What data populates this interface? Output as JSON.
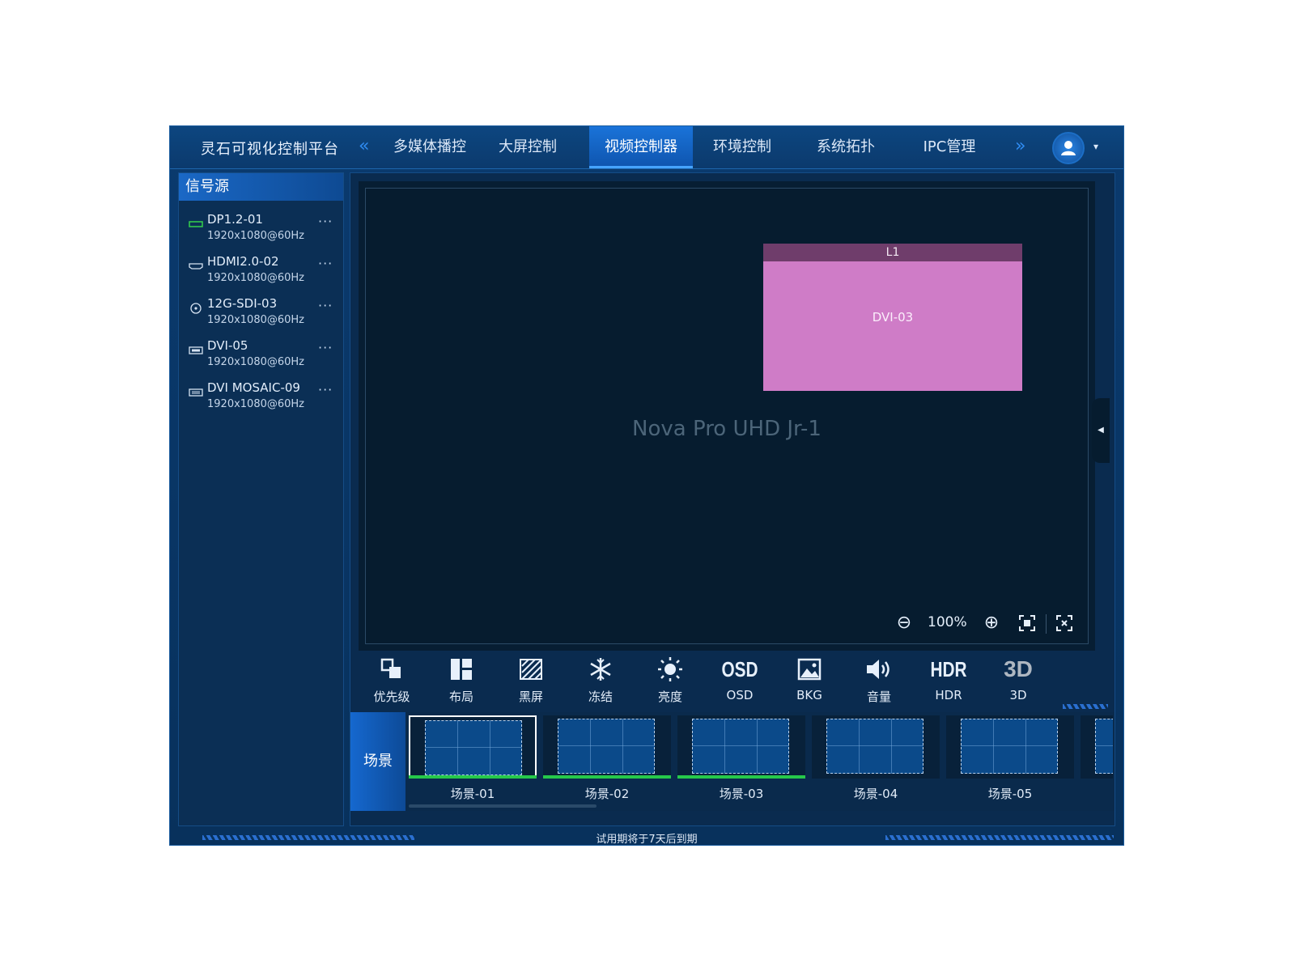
{
  "header": {
    "app_title": "灵石可视化控制平台",
    "nav_prev": "«",
    "nav_next": "»",
    "tabs": [
      {
        "label": "多媒体播控"
      },
      {
        "label": "大屏控制"
      },
      {
        "label": "视频控制器",
        "active": true
      },
      {
        "label": "环境控制"
      },
      {
        "label": "系统拓扑"
      },
      {
        "label": "IPC管理"
      }
    ],
    "avatar_icon": "user-icon",
    "avatar_caret": "▾"
  },
  "sidebar": {
    "title": "信号源",
    "items": [
      {
        "name": "DP1.2-01",
        "resolution": "1920x1080@60Hz",
        "icon": "displayport-icon",
        "more": "···"
      },
      {
        "name": "HDMI2.0-02",
        "resolution": "1920x1080@60Hz",
        "icon": "hdmi-icon",
        "more": "···"
      },
      {
        "name": "12G-SDI-03",
        "resolution": "1920x1080@60Hz",
        "icon": "sdi-icon",
        "more": "···"
      },
      {
        "name": "DVI-05",
        "resolution": "1920x1080@60Hz",
        "icon": "dvi-icon",
        "more": "···"
      },
      {
        "name": "DVI MOSAIC-09",
        "resolution": "1920x1080@60Hz",
        "icon": "dvi-mosaic-icon",
        "more": "···"
      }
    ]
  },
  "canvas": {
    "device_name": "Nova Pro UHD Jr-1",
    "layer": {
      "title": "L1",
      "source": "DVI-03",
      "color": "#cf7cc7"
    },
    "zoom": {
      "level": "100%",
      "minus": "⊖",
      "plus": "⊕"
    }
  },
  "toolbar": {
    "tools": [
      {
        "label": "优先级",
        "icon": "priority-icon"
      },
      {
        "label": "布局",
        "icon": "layout-icon"
      },
      {
        "label": "黑屏",
        "icon": "blackout-icon"
      },
      {
        "label": "冻结",
        "icon": "freeze-icon"
      },
      {
        "label": "亮度",
        "icon": "brightness-icon"
      },
      {
        "label": "OSD",
        "icon": "osd-icon",
        "glyph": "OSD"
      },
      {
        "label": "BKG",
        "icon": "background-image-icon"
      },
      {
        "label": "音量",
        "icon": "volume-icon"
      },
      {
        "label": "HDR",
        "icon": "hdr-icon",
        "glyph": "HDR"
      },
      {
        "label": "3D",
        "icon": "3d-icon",
        "glyph": "3D"
      }
    ]
  },
  "scenes": {
    "label": "场景",
    "items": [
      {
        "name": "场景-01",
        "selected": true,
        "active": true
      },
      {
        "name": "场景-02",
        "active": true
      },
      {
        "name": "场景-03",
        "active": true
      },
      {
        "name": "场景-04",
        "active": false
      },
      {
        "name": "场景-05",
        "active": false
      }
    ]
  },
  "footer": {
    "notice": "试用期将于7天后到期"
  },
  "colors": {
    "accent": "#1a73d9",
    "active_scene": "#26c94a",
    "layer": "#cf7cc7"
  }
}
